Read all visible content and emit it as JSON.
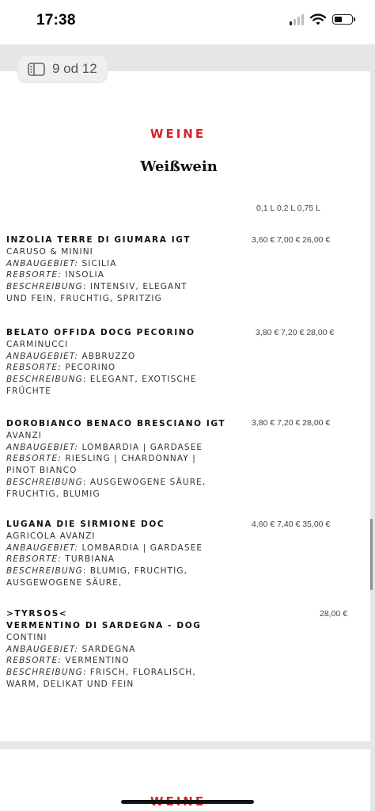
{
  "status_bar": {
    "time": "17:38",
    "battery_level": 0.35,
    "signal_bars_active": 1
  },
  "viewer": {
    "page_indicator": "9 od 12"
  },
  "menu": {
    "section_title": "WEINE",
    "subsection_title": "Weißwein",
    "sizes_header": "0,1 L 0,2 L 0,75 L",
    "wines": [
      {
        "name": "INZOLIA TERRE DI GIUMARA IGT",
        "producer": "CARUSO & MININI",
        "region_label": "ANBAUGEBIET:",
        "region": "SICILIA",
        "grape_label": "REBSORTE:",
        "grape": "INSOLIA",
        "desc_label": "BESCHREIBUNG",
        "desc_line1": ": INTENSIV, ELEGANT",
        "desc_line2": "UND FEIN, FRUCHTIG, SPRITZIG",
        "price": "3,60 € 7,00 € 26,00 €"
      },
      {
        "name": "BELATO OFFIDA DOCG PECORINO",
        "producer": "CARMINUCCI",
        "region_label": "ANBAUGEBIET:",
        "region": "ABBRUZZO",
        "grape_label": "REBSORTE:",
        "grape": "PECORINO",
        "desc_label": "BESCHREIBUNG",
        "desc_line1": ": ELEGANT, EXOTISCHE",
        "desc_line2": "FRÜCHTE",
        "price": "3,80 € 7,20 € 28,00 €"
      },
      {
        "name": "DOROBIANCO BENACO BRESCIANO IGT",
        "producer": "AVANZI",
        "region_label": "ANBAUGEBIET:",
        "region": "LOMBARDIA | GARDASEE",
        "grape_label": "REBSORTE:",
        "grape": "RIESLING | CHARDONNAY |",
        "grape_line2": "PINOT BIANCO",
        "desc_label": "BESCHREIBUNG",
        "desc_line1": ": AUSGEWOGENE SÄURE,",
        "desc_line2": "FRUCHTIG, BLUMIG",
        "price": "3,80 € 7,20 € 28,00 €"
      },
      {
        "name": "LUGANA DIE SIRMIONE DOC",
        "producer": "AGRICOLA AVANZI",
        "region_label": "ANBAUGEBIET:",
        "region": "LOMBARDIA | GARDASEE",
        "grape_label": "REBSORTE:",
        "grape": "TURBIANA",
        "desc_label": "BESCHREIBUNG",
        "desc_line1": ": BLUMIG, FRUCHTIG,",
        "desc_line2": "AUSGEWOGENE SÄURE,",
        "price": "4,60 € 7,40 € 35,00 €"
      },
      {
        "name": ">TYRSOS<",
        "name_line2": "VERMENTINO DI SARDEGNA - DOG",
        "producer": "CONTINI",
        "region_label": "ANBAUGEBIET:",
        "region": "SARDEGNA",
        "grape_label": "REBSORTE:",
        "grape": "VERMENTINO",
        "desc_label": "BESCHREIBUNG",
        "desc_line1": ": FRISCH, FLORALISCH,",
        "desc_line2": "WARM, DELIKAT UND FEIN",
        "price": "28,00 €"
      }
    ],
    "next_section_title": "WEINE"
  }
}
